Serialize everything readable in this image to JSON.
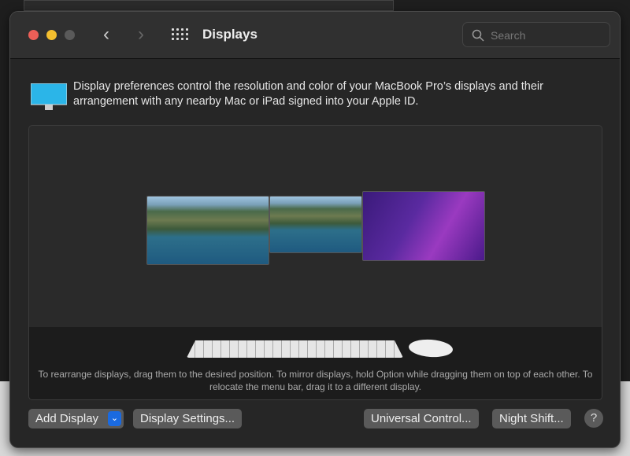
{
  "window": {
    "title": "Displays",
    "search_placeholder": "Search"
  },
  "icons": [
    "close",
    "minimize",
    "zoom",
    "chevron-left",
    "chevron-right",
    "grid",
    "search",
    "display",
    "keyboard",
    "mouse",
    "help"
  ],
  "info_text": "Display preferences control the resolution and color of your MacBook Pro’s displays and their arrangement with any nearby Mac or iPad signed into your Apple ID.",
  "arrangement_hint": "To rearrange displays, drag them to the desired position. To mirror displays, hold Option while dragging them on top of each other. To relocate the menu bar, drag it to a different display.",
  "buttons": {
    "add_display": "Add Display",
    "display_settings": "Display Settings...",
    "universal_control": "Universal Control...",
    "night_shift": "Night Shift...",
    "help": "?"
  },
  "colors": {
    "close": "#ec5f57",
    "minimize": "#f4bf2f",
    "accent": "#1a6ae0"
  }
}
